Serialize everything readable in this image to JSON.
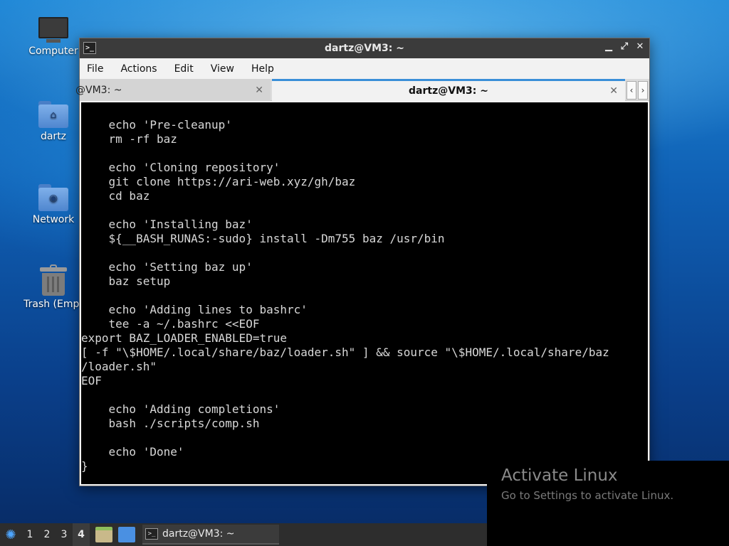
{
  "desktop": {
    "icons": [
      {
        "label": "Computer",
        "icon": "computer-icon"
      },
      {
        "label": "dartz",
        "icon": "home-folder-icon"
      },
      {
        "label": "Network",
        "icon": "network-folder-icon"
      },
      {
        "label": "Trash (Empt",
        "icon": "trash-icon"
      }
    ]
  },
  "window": {
    "title": "dartz@VM3: ~",
    "menu": [
      "File",
      "Actions",
      "Edit",
      "View",
      "Help"
    ],
    "tabs": [
      {
        "label": "@VM3: ~",
        "active": false
      },
      {
        "label": "dartz@VM3: ~",
        "active": true
      }
    ],
    "terminal_lines": [
      "    echo 'Pre-cleanup'",
      "    rm -rf baz",
      "",
      "    echo 'Cloning repository'",
      "    git clone https://ari-web.xyz/gh/baz",
      "    cd baz",
      "",
      "    echo 'Installing baz'",
      "    ${__BASH_RUNAS:-sudo} install -Dm755 baz /usr/bin",
      "",
      "    echo 'Setting baz up'",
      "    baz setup",
      "",
      "    echo 'Adding lines to bashrc'",
      "    tee -a ~/.bashrc <<EOF",
      "export BAZ_LOADER_ENABLED=true",
      "[ -f \"\\$HOME/.local/share/baz/loader.sh\" ] && source \"\\$HOME/.local/share/baz",
      "/loader.sh\"",
      "EOF",
      "",
      "    echo 'Adding completions'",
      "    bash ./scripts/comp.sh",
      "",
      "    echo 'Done'",
      "}"
    ]
  },
  "activation": {
    "title": "Activate Linux",
    "subtitle": "Go to Settings to activate Linux."
  },
  "taskbar": {
    "workspaces": [
      "1",
      "2",
      "3",
      "4"
    ],
    "current_workspace": "4",
    "task_label": "dartz@VM3: ~"
  }
}
